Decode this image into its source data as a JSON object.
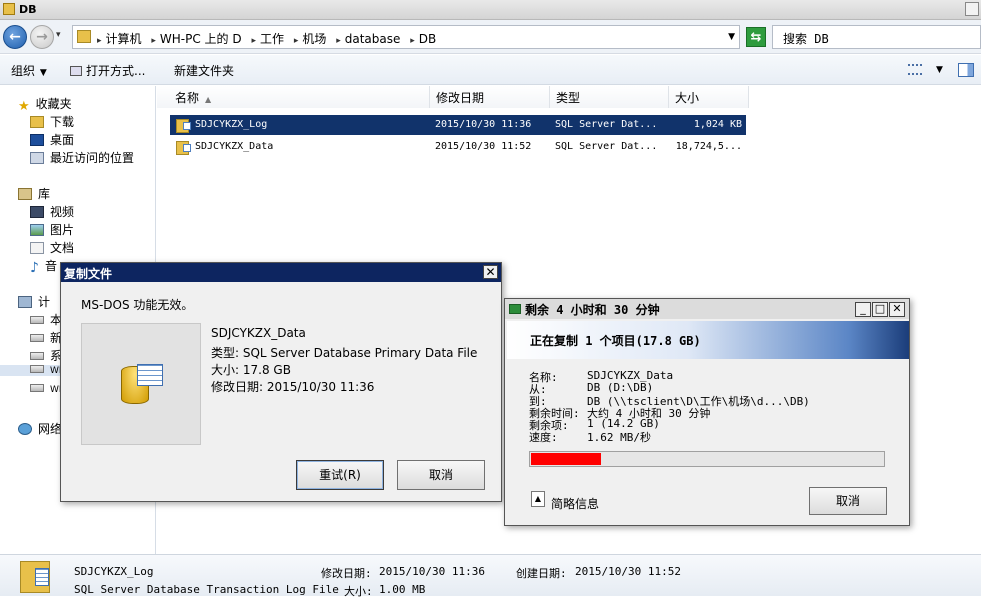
{
  "window": {
    "title": "DB"
  },
  "address": {
    "crumbs": [
      "计算机",
      "WH-PC 上的 D",
      "工作",
      "机场",
      "database",
      "DB"
    ],
    "search_placeholder": "搜索 DB"
  },
  "toolbar": {
    "organize": "组织",
    "open_with": "打开方式...",
    "new_folder": "新建文件夹"
  },
  "nav": {
    "favorites": "收藏夹",
    "downloads": "下载",
    "desktop": "桌面",
    "recent": "最近访问的位置",
    "libraries": "库",
    "videos": "视频",
    "pictures": "图片",
    "documents": "文档",
    "music": "音",
    "computer": "计",
    "c1": "本",
    "c2": "新",
    "c3": "系",
    "c4": "WF",
    "c5": "WF",
    "network": "网络"
  },
  "columns": {
    "name": "名称",
    "modified": "修改日期",
    "type": "类型",
    "size": "大小"
  },
  "files": [
    {
      "name": "SDJCYKZX_Log",
      "modified": "2015/10/30 11:36",
      "type": "SQL Server Dat...",
      "size": "1,024 KB"
    },
    {
      "name": "SDJCYKZX_Data",
      "modified": "2015/10/30 11:52",
      "type": "SQL Server Dat...",
      "size": "18,724,5..."
    }
  ],
  "copy_dialog": {
    "title": "复制文件",
    "message": "MS-DOS 功能无效。",
    "filename": "SDJCYKZX_Data",
    "type": "类型: SQL Server Database Primary Data File",
    "size": "大小: 17.8 GB",
    "modified": "修改日期: 2015/10/30 11:36",
    "retry": "重试(R)",
    "cancel": "取消"
  },
  "progress_dialog": {
    "title": "剩余 4 小时和 30 分钟",
    "header": "正在复制 1 个项目(17.8 GB)",
    "rows": [
      {
        "label": "名称:",
        "value": "SDJCYKZX_Data"
      },
      {
        "label": "从:",
        "value": "DB (D:\\DB)"
      },
      {
        "label": "到:",
        "value": "DB (\\\\tsclient\\D\\工作\\机场\\d...\\DB)"
      },
      {
        "label": "剩余时间:",
        "value": "大约 4 小时和 30 分钟"
      },
      {
        "label": "剩余项:",
        "value": "1 (14.2 GB)"
      },
      {
        "label": "速度:",
        "value": "1.62 MB/秒"
      }
    ],
    "progress_fraction": 0.2,
    "progress_color": "#ff0000",
    "brief": "简略信息",
    "cancel": "取消"
  },
  "details": {
    "name": "SDJCYKZX_Log",
    "type": "SQL Server Database Transaction Log File",
    "modified_label": "修改日期:",
    "modified": "2015/10/30 11:36",
    "created_label": "创建日期:",
    "created": "2015/10/30 11:52",
    "size_label": "大小:",
    "size": "1.00 MB"
  },
  "colors": {
    "selection": "#11336b",
    "dialog_title": "#0d2560"
  }
}
